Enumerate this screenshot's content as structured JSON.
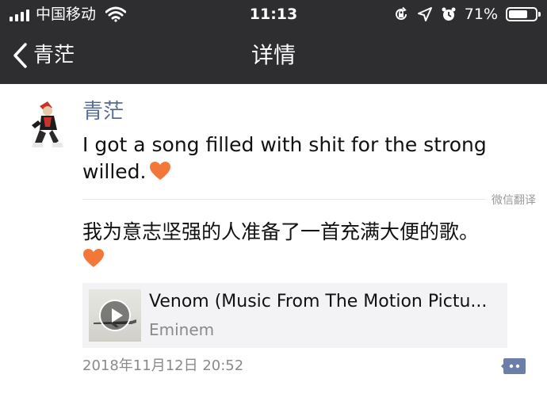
{
  "status_bar": {
    "carrier": "中国移动",
    "time": "11:13",
    "battery_percent": "71%",
    "battery_level": 0.71,
    "icons": [
      "signal-icon",
      "wifi-icon",
      "orientation-lock-icon",
      "location-arrow-icon",
      "alarm-clock-icon",
      "battery-icon"
    ]
  },
  "nav": {
    "back_label": "青茫",
    "title": "详情"
  },
  "post": {
    "username": "青茫",
    "text": "I got a song filled with shit for the strong willed.",
    "emoji": "orange-heart-icon",
    "translate_label": "微信翻译",
    "translated_text": "我为意志坚强的人准备了一首充满大便的歌。",
    "music": {
      "title": "Venom (Music From The Motion Pictu...",
      "artist": "Eminem"
    },
    "timestamp": "2018年11月12日 20:52"
  },
  "colors": {
    "bar_bg": "#2e2e30",
    "name_link": "#576b95",
    "heart": "#f4773a",
    "music_card_bg": "#f3f3f5",
    "comment_icon": "#576b95"
  }
}
